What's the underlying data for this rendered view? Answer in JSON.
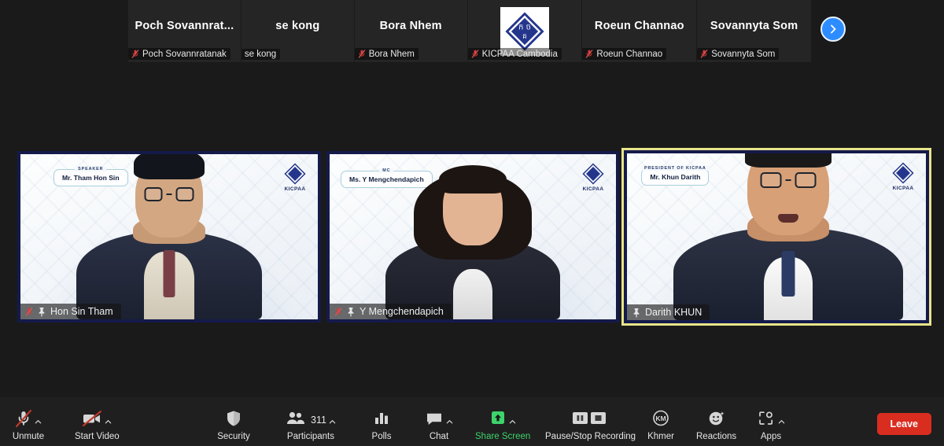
{
  "filmstrip": {
    "thumbnails": [
      {
        "display_name": "Poch  Sovannrat...",
        "label": "Poch Sovannratanak",
        "muted": true,
        "has_logo": false
      },
      {
        "display_name": "se kong",
        "label": "se kong",
        "muted": false,
        "has_logo": false
      },
      {
        "display_name": "Bora Nhem",
        "label": "Bora Nhem",
        "muted": true,
        "has_logo": false
      },
      {
        "display_name": "",
        "label": "KICPAA Cambodia",
        "muted": true,
        "has_logo": true
      },
      {
        "display_name": "Roeun Channao",
        "label": "Roeun Channao",
        "muted": true,
        "has_logo": false
      },
      {
        "display_name": "Sovannyta Som",
        "label": "Sovannyta Som",
        "muted": true,
        "has_logo": false
      }
    ],
    "next_page_icon": "chevron-right-icon",
    "next_page_color": "#2d8cff"
  },
  "tiles": [
    {
      "participant": "Hon Sin Tham",
      "nameplate_kicker": "SPEAKER",
      "nameplate_name": "Mr. Tham Hon Sin",
      "logo_text": "KICPAA",
      "muted": true,
      "pinned": true,
      "active_speaker": false
    },
    {
      "participant": "Y Mengchendapich",
      "nameplate_kicker": "MC",
      "nameplate_name": "Ms. Y Mengchendapich",
      "logo_text": "KICPAA",
      "muted": true,
      "pinned": true,
      "active_speaker": false
    },
    {
      "participant": "Darith KHUN",
      "nameplate_kicker": "PRESIDENT OF KICPAA",
      "nameplate_name": "Mr. Khun Darith",
      "logo_text": "KICPAA",
      "muted": false,
      "pinned": true,
      "active_speaker": true,
      "active_border_color": "#e8e48a"
    }
  ],
  "toolbar": {
    "audio": {
      "label": "Unmute",
      "icon": "microphone-muted-icon",
      "has_caret": true
    },
    "video": {
      "label": "Start Video",
      "icon": "video-camera-off-icon",
      "has_caret": true
    },
    "security": {
      "label": "Security",
      "icon": "shield-icon",
      "has_caret": false
    },
    "participants": {
      "label": "Participants",
      "icon": "people-icon",
      "count": "311",
      "has_caret": true
    },
    "polls": {
      "label": "Polls",
      "icon": "bar-chart-icon",
      "has_caret": false
    },
    "chat": {
      "label": "Chat",
      "icon": "speech-bubble-icon",
      "has_caret": true
    },
    "share": {
      "label": "Share Screen",
      "icon": "share-screen-up-arrow-icon",
      "has_caret": true,
      "color": "#3dd36b"
    },
    "recording": {
      "label": "Pause/Stop Recording",
      "icon": "pause-stop-recording-icon",
      "has_caret": false
    },
    "interpretation": {
      "label": "Khmer",
      "icon": "interpretation-km-icon",
      "badge": "KM",
      "has_caret": false
    },
    "reactions": {
      "label": "Reactions",
      "icon": "smiley-reaction-icon",
      "has_caret": false
    },
    "apps": {
      "label": "Apps",
      "icon": "apps-bracket-icon",
      "has_caret": true
    },
    "leave": {
      "label": "Leave",
      "color": "#d92d20"
    }
  }
}
